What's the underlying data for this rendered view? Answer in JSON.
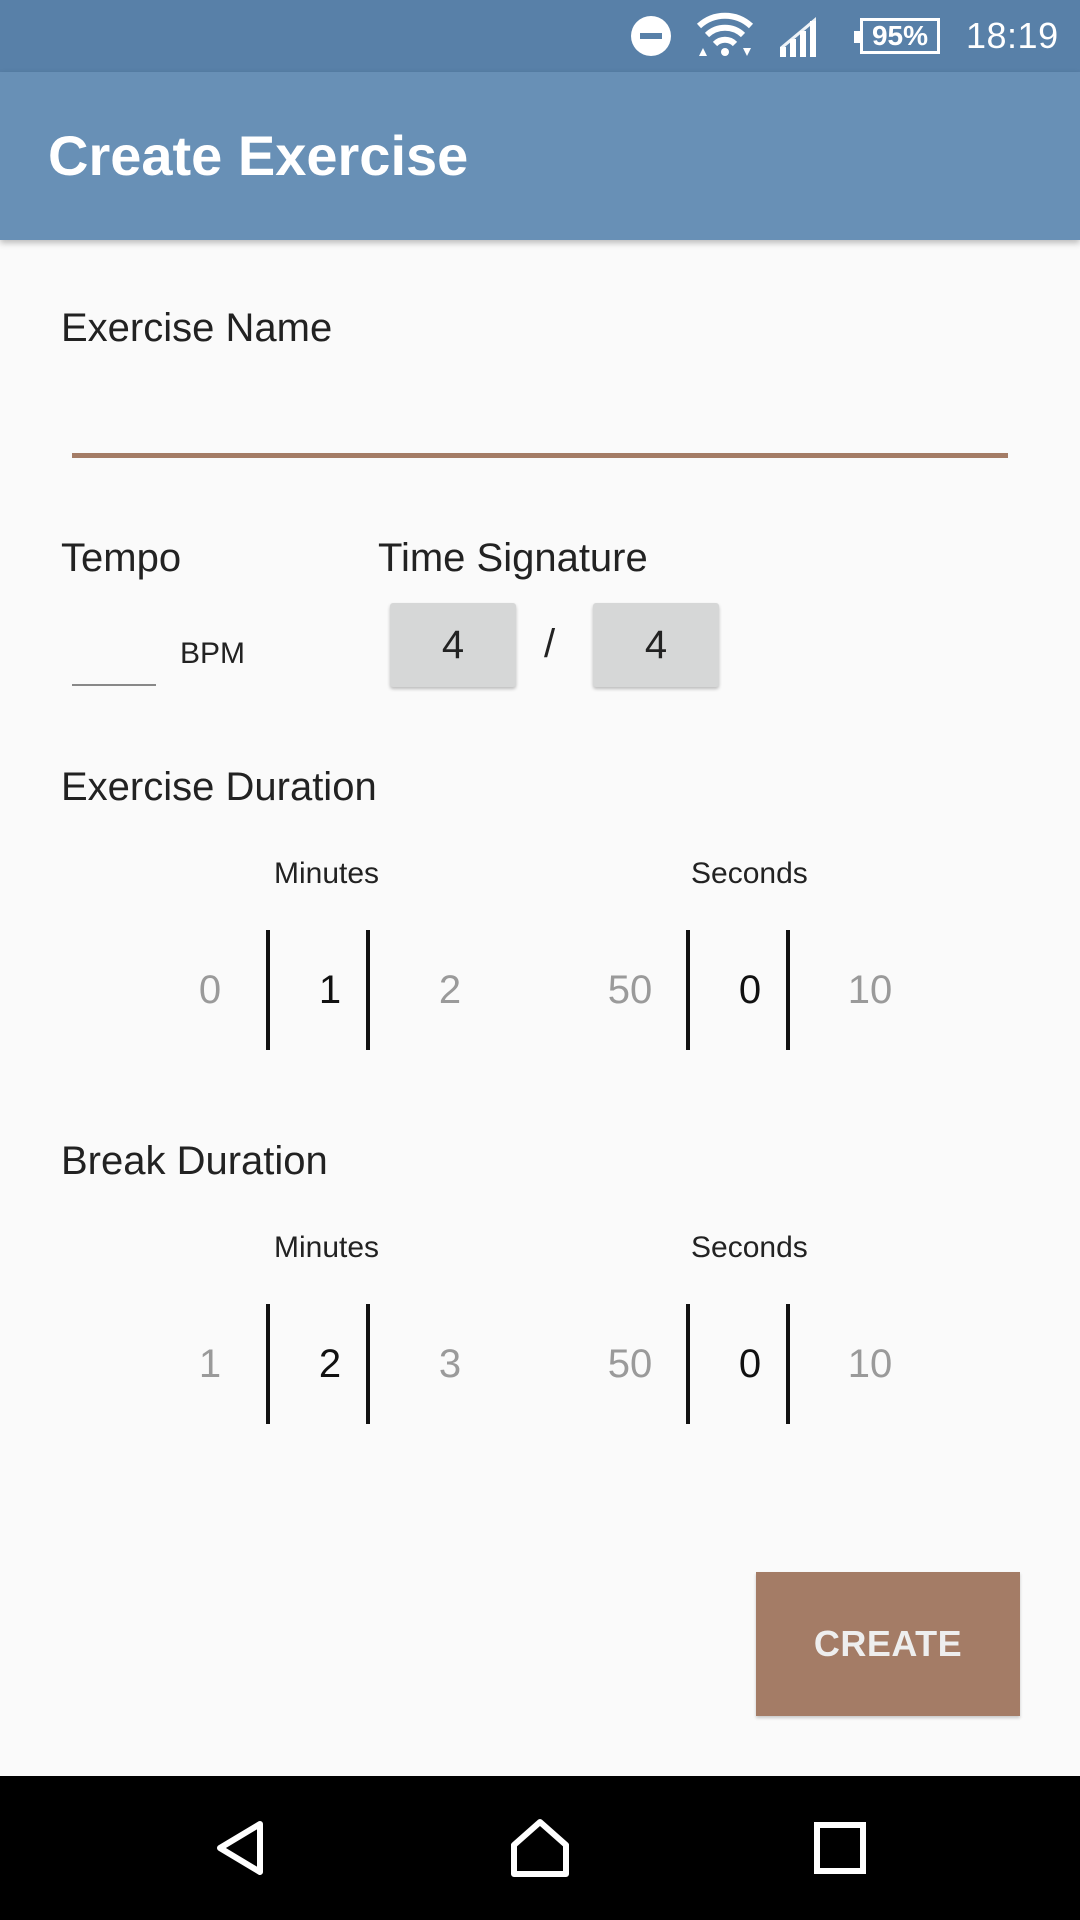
{
  "status_bar": {
    "battery": "95%",
    "time": "18:19",
    "icons": [
      "do-not-disturb-icon",
      "wifi-icon",
      "signal-icon",
      "battery-icon"
    ]
  },
  "app_bar": {
    "title": "Create Exercise"
  },
  "form": {
    "exercise_name_label": "Exercise Name",
    "exercise_name_value": "",
    "tempo_label": "Tempo",
    "tempo_value": "",
    "bpm_label": "BPM",
    "time_signature_label": "Time Signature",
    "time_signature_top": "4",
    "time_signature_separator": "/",
    "time_signature_bottom": "4",
    "exercise_duration": {
      "label": "Exercise Duration",
      "minutes": {
        "label": "Minutes",
        "prev": "0",
        "current": "1",
        "next": "2"
      },
      "seconds": {
        "label": "Seconds",
        "prev": "50",
        "current": "0",
        "next": "10"
      }
    },
    "break_duration": {
      "label": "Break Duration",
      "minutes": {
        "label": "Minutes",
        "prev": "1",
        "current": "2",
        "next": "3"
      },
      "seconds": {
        "label": "Seconds",
        "prev": "50",
        "current": "0",
        "next": "10"
      }
    },
    "create_label": "CREATE"
  },
  "colors": {
    "status_bar": "#5880a8",
    "app_bar": "#6890b6",
    "accent": "#a47c66",
    "background": "#fafafa"
  },
  "nav_bar": {
    "icons": [
      "back-icon",
      "home-icon",
      "recents-icon"
    ]
  }
}
